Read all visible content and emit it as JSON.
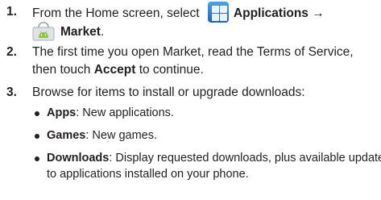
{
  "steps": [
    {
      "number": "1.",
      "segments": [
        {
          "text": "From the Home screen, select ",
          "bold": false
        },
        {
          "icon": "applications-grid-icon"
        },
        {
          "text": "Applications →",
          "bold": true
        },
        {
          "icon": "market-shopping-bag-icon"
        },
        {
          "text": "Market",
          "bold": true
        },
        {
          "text": ".",
          "bold": false
        }
      ]
    },
    {
      "number": "2.",
      "line1": "The first time you open Market, read the Terms of Service,",
      "line2_pre": "then touch ",
      "line2_bold": "Accept",
      "line2_post": " to continue."
    },
    {
      "number": "3.",
      "text": "Browse for items to install or upgrade downloads:"
    }
  ],
  "bullets": [
    {
      "term": "Apps",
      "desc": ": New applications."
    },
    {
      "term": "Games",
      "desc": ": New games."
    },
    {
      "term": "Downloads",
      "desc": ": Display requested downloads, plus available updates",
      "desc2": "to applications installed on your phone."
    }
  ],
  "colors": {
    "text": "#231f20",
    "apps_icon": "#1e7ad2",
    "market_bag": "#dfe3e6",
    "android_green": "#8cc63f"
  }
}
